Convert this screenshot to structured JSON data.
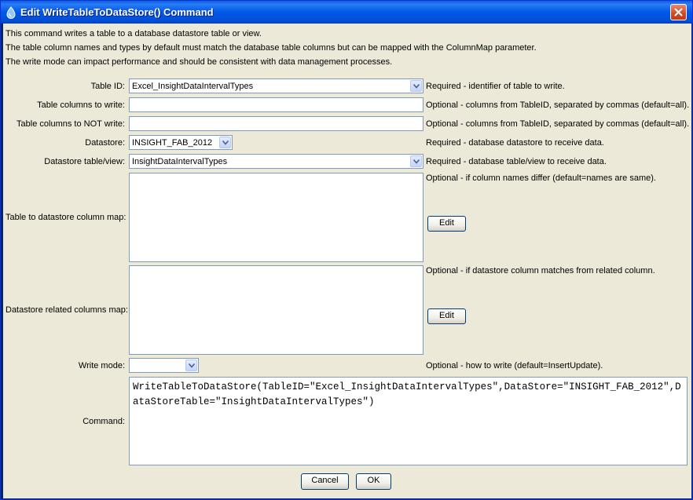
{
  "window": {
    "title": "Edit WriteTableToDataStore() Command",
    "icons": {
      "app": "water-drop-icon",
      "close": "close-icon"
    }
  },
  "description": [
    "This command writes a table to a database datastore table or view.",
    "The table column names and types by default must match the database table columns but can be mapped with the ColumnMap parameter.",
    "The write mode can impact performance and should be consistent with data management processes."
  ],
  "fields": {
    "table_id": {
      "label": "Table ID:",
      "value": "Excel_InsightDataIntervalTypes",
      "note": "Required - identifier of table to write."
    },
    "include_columns": {
      "label": "Table columns to write:",
      "value": "",
      "note": "Optional - columns from TableID, separated by commas (default=all)."
    },
    "exclude_columns": {
      "label": "Table columns to NOT write:",
      "value": "",
      "note": "Optional - columns from TableID, separated by commas (default=all)."
    },
    "datastore": {
      "label": "Datastore:",
      "value": "INSIGHT_FAB_2012",
      "note": "Required - database datastore to receive data."
    },
    "datastore_table": {
      "label": "Datastore table/view:",
      "value": "InsightDataIntervalTypes",
      "note": "Required - database table/view to receive data."
    },
    "column_map": {
      "label": "Table to datastore column map:",
      "value": "",
      "note": "Optional - if column names differ (default=names are same).",
      "edit_label": "Edit"
    },
    "related_columns_map": {
      "label": "Datastore related columns map:",
      "value": "",
      "note": "Optional - if datastore column matches from related column.",
      "edit_label": "Edit"
    },
    "write_mode": {
      "label": "Write mode:",
      "value": "",
      "note": "Optional - how to write (default=InsertUpdate)."
    },
    "command": {
      "label": "Command:",
      "value": "WriteTableToDataStore(TableID=\"Excel_InsightDataIntervalTypes\",DataStore=\"INSIGHT_FAB_2012\",DataStoreTable=\"InsightDataIntervalTypes\")"
    }
  },
  "buttons": {
    "cancel": "Cancel",
    "ok": "OK"
  },
  "colors": {
    "titlebar": "#0058e6",
    "dialog_bg": "#ece9d8",
    "field_border": "#7f9db9"
  }
}
